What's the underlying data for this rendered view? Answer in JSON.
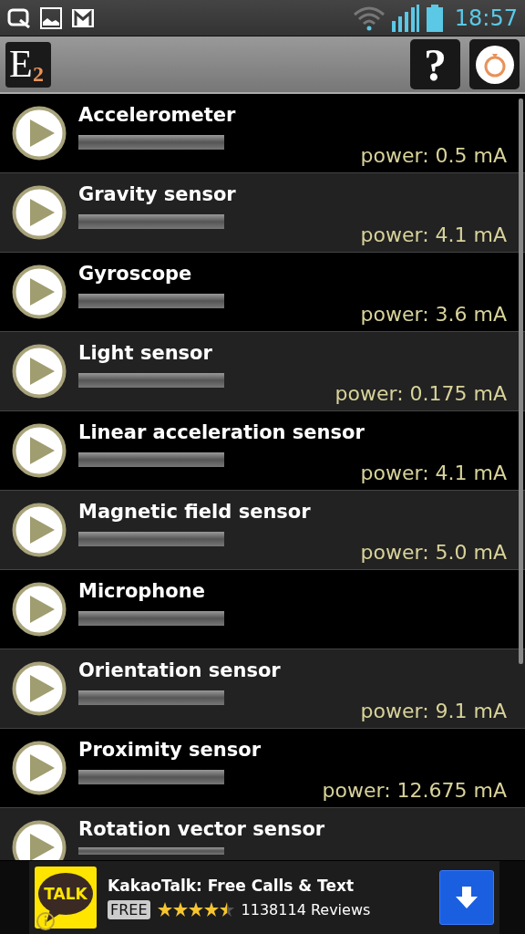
{
  "status_bar": {
    "time": "18:57"
  },
  "toolbar": {
    "logo": {
      "letter": "E",
      "index": "2"
    },
    "help_label": "?"
  },
  "sensors": [
    {
      "name": "Accelerometer",
      "power": "power: 0.5 mA"
    },
    {
      "name": "Gravity sensor",
      "power": "power: 4.1 mA"
    },
    {
      "name": "Gyroscope",
      "power": "power: 3.6 mA"
    },
    {
      "name": "Light sensor",
      "power": "power: 0.175 mA"
    },
    {
      "name": "Linear acceleration sensor",
      "power": "power: 4.1 mA"
    },
    {
      "name": "Magnetic field sensor",
      "power": "power: 5.0 mA"
    },
    {
      "name": "Microphone"
    },
    {
      "name": "Orientation sensor",
      "power": "power: 9.1 mA"
    },
    {
      "name": "Proximity sensor",
      "power": "power: 12.675 mA"
    },
    {
      "name": "Rotation vector sensor"
    }
  ],
  "ad": {
    "logo_text": "TALK",
    "title": "KakaoTalk: Free Calls & Text",
    "price": "FREE",
    "stars": 4.5,
    "reviews": "1138114 Reviews"
  }
}
